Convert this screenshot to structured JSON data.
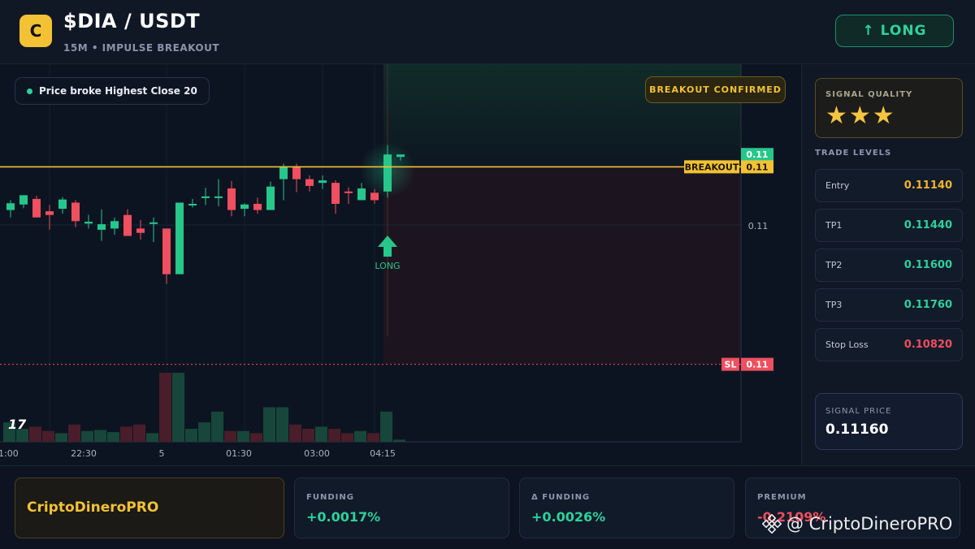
{
  "header": {
    "logo_letter": "C",
    "pair": "$DIA / USDT",
    "subtitle": "15M • IMPULSE BREAKOUT",
    "direction_button": "↑ LONG"
  },
  "chart": {
    "note_badge": "Price broke Highest Close 20",
    "confirm_badge": "BREAKOUT CONFIRMED",
    "watermark_logo": "17",
    "price_axis": {
      "mid_label": "0.11"
    },
    "price_tags": {
      "current": "0.11",
      "breakout_label": "BREAKOUT",
      "breakout_value": "0.11",
      "sl_label": "SL",
      "sl_value": "0.11"
    },
    "signal_marker": "LONG",
    "time_labels": [
      "1:00",
      "22:30",
      "5",
      "01:30",
      "03:00",
      "04:15"
    ],
    "colors": {
      "up": "#26c78a",
      "down": "#ef4f5f",
      "breakout": "#f3c234",
      "stop": "#ef4f5f"
    }
  },
  "chart_data": {
    "type": "candlestick",
    "levels": {
      "breakout": 0.1114,
      "stop_loss": 0.1082
    },
    "ylim": [
      0.1078,
      0.1128
    ],
    "candles": [
      {
        "o": 0.1107,
        "h": 0.11086,
        "l": 0.11058,
        "c": 0.11081,
        "v": 0.9
      },
      {
        "o": 0.11079,
        "h": 0.11094,
        "l": 0.11073,
        "c": 0.11094,
        "v": 0.6
      },
      {
        "o": 0.11088,
        "h": 0.11093,
        "l": 0.11058,
        "c": 0.11058,
        "v": 0.7
      },
      {
        "o": 0.11068,
        "h": 0.11078,
        "l": 0.11038,
        "c": 0.11062,
        "v": 0.5
      },
      {
        "o": 0.11072,
        "h": 0.11091,
        "l": 0.11064,
        "c": 0.11087,
        "v": 0.4
      },
      {
        "o": 0.11082,
        "h": 0.11086,
        "l": 0.11042,
        "c": 0.11052,
        "v": 0.8
      },
      {
        "o": 0.11048,
        "h": 0.11062,
        "l": 0.1104,
        "c": 0.11051,
        "v": 0.5
      },
      {
        "o": 0.11038,
        "h": 0.11071,
        "l": 0.1102,
        "c": 0.11047,
        "v": 0.55
      },
      {
        "o": 0.1104,
        "h": 0.11058,
        "l": 0.1103,
        "c": 0.11052,
        "v": 0.45
      },
      {
        "o": 0.11062,
        "h": 0.11071,
        "l": 0.11032,
        "c": 0.11028,
        "v": 0.7
      },
      {
        "o": 0.1104,
        "h": 0.11054,
        "l": 0.11022,
        "c": 0.11033,
        "v": 0.8
      },
      {
        "o": 0.11048,
        "h": 0.11058,
        "l": 0.11018,
        "c": 0.1105,
        "v": 0.4
      },
      {
        "o": 0.1104,
        "h": 0.1104,
        "l": 0.1095,
        "c": 0.10966,
        "v": 3.2
      },
      {
        "o": 0.10966,
        "h": 0.11082,
        "l": 0.10966,
        "c": 0.11082,
        "v": 3.2
      },
      {
        "o": 0.1108,
        "h": 0.11088,
        "l": 0.11074,
        "c": 0.1108,
        "v": 0.6
      },
      {
        "o": 0.11092,
        "h": 0.11106,
        "l": 0.11078,
        "c": 0.11092,
        "v": 0.9
      },
      {
        "o": 0.11092,
        "h": 0.1112,
        "l": 0.11076,
        "c": 0.11092,
        "v": 1.4
      },
      {
        "o": 0.11105,
        "h": 0.11117,
        "l": 0.1106,
        "c": 0.1107,
        "v": 0.5
      },
      {
        "o": 0.11072,
        "h": 0.11081,
        "l": 0.1106,
        "c": 0.11079,
        "v": 0.5
      },
      {
        "o": 0.1108,
        "h": 0.1109,
        "l": 0.11064,
        "c": 0.1107,
        "v": 0.4
      },
      {
        "o": 0.1107,
        "h": 0.11116,
        "l": 0.1107,
        "c": 0.11108,
        "v": 1.6
      },
      {
        "o": 0.1112,
        "h": 0.11145,
        "l": 0.11086,
        "c": 0.1114,
        "v": 1.6
      },
      {
        "o": 0.1114,
        "h": 0.11145,
        "l": 0.11099,
        "c": 0.1112,
        "v": 0.8
      },
      {
        "o": 0.1112,
        "h": 0.11126,
        "l": 0.111,
        "c": 0.11109,
        "v": 0.6
      },
      {
        "o": 0.11114,
        "h": 0.11126,
        "l": 0.11104,
        "c": 0.11118,
        "v": 0.7
      },
      {
        "o": 0.11114,
        "h": 0.11118,
        "l": 0.11064,
        "c": 0.1108,
        "v": 0.6
      },
      {
        "o": 0.111,
        "h": 0.11107,
        "l": 0.1108,
        "c": 0.11098,
        "v": 0.4
      },
      {
        "o": 0.11086,
        "h": 0.11114,
        "l": 0.11086,
        "c": 0.11105,
        "v": 0.5
      },
      {
        "o": 0.11098,
        "h": 0.11104,
        "l": 0.1108,
        "c": 0.11086,
        "v": 0.4
      },
      {
        "o": 0.111,
        "h": 0.11175,
        "l": 0.1109,
        "c": 0.1116,
        "v": 1.4
      },
      {
        "o": 0.11156,
        "h": 0.1116,
        "l": 0.1115,
        "c": 0.1116,
        "v": 0.1
      }
    ]
  },
  "signal_quality": {
    "title": "SIGNAL QUALITY",
    "stars": "★★★",
    "rating": 3
  },
  "trade_levels": {
    "title": "TRADE LEVELS",
    "items": [
      {
        "label": "Entry",
        "value": "0.11140",
        "color": "#f3b52b"
      },
      {
        "label": "TP1",
        "value": "0.11440",
        "color": "#2ed19a"
      },
      {
        "label": "TP2",
        "value": "0.11600",
        "color": "#2ed19a"
      },
      {
        "label": "TP3",
        "value": "0.11760",
        "color": "#2ed19a"
      },
      {
        "label": "Stop Loss",
        "value": "0.10820",
        "color": "#ef4f5f"
      }
    ]
  },
  "signal_price": {
    "title": "SIGNAL PRICE",
    "value": "0.11160"
  },
  "footer": {
    "brand": "CriptoDineroPRO",
    "stats": [
      {
        "title": "FUNDING",
        "value": "+0.0017%",
        "color": "#2ed19a"
      },
      {
        "title": "Δ FUNDING",
        "value": "+0.0026%",
        "color": "#2ed19a"
      },
      {
        "title": "PREMIUM",
        "value": "-0.2109%",
        "color": "#ef4f5f"
      }
    ],
    "watermark": "@ CriptoDineroPRO"
  }
}
